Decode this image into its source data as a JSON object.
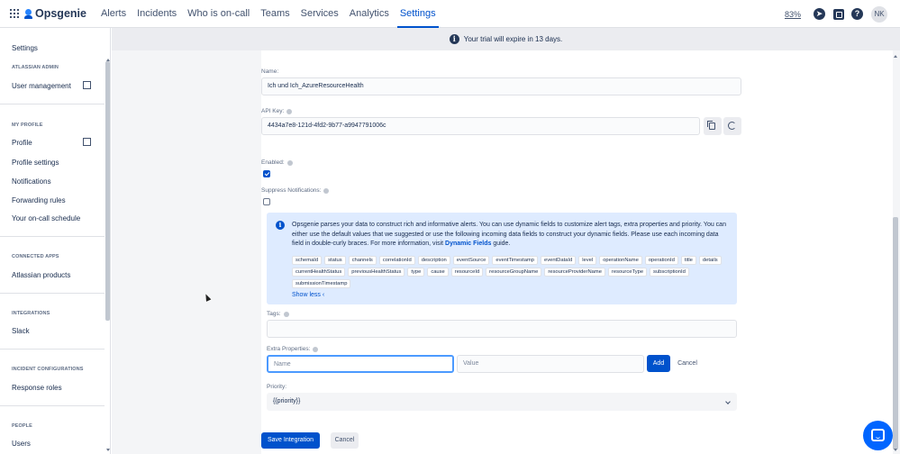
{
  "app": {
    "name": "Opsgenie"
  },
  "topnav": {
    "items": [
      "Alerts",
      "Incidents",
      "Who is on-call",
      "Teams",
      "Services",
      "Analytics",
      "Settings"
    ],
    "active": "Settings",
    "zoom": "83%",
    "avatar_initials": "NK"
  },
  "sidebar": {
    "settings": "Settings",
    "atlassian_admin_head": "ATLASSIAN ADMIN",
    "user_management": "User management",
    "my_profile_head": "MY PROFILE",
    "profile": "Profile",
    "profile_settings": "Profile settings",
    "notifications": "Notifications",
    "forwarding_rules": "Forwarding rules",
    "oncall_schedule": "Your on-call schedule",
    "connected_apps_head": "CONNECTED APPS",
    "atlassian_products": "Atlassian products",
    "integrations_head": "INTEGRATIONS",
    "slack": "Slack",
    "incident_config_head": "INCIDENT CONFIGURATIONS",
    "response_roles": "Response roles",
    "people_head": "PEOPLE",
    "users": "Users"
  },
  "banner": {
    "trial_text": "Your trial will expire in 13 days."
  },
  "form": {
    "name_label": "Name:",
    "name_value": "Ich und Ich_AzureResourceHealth",
    "api_key_label": "API Key:",
    "api_key_value": "4434a7e8-121d-4fd2-9b77-a9947791006c",
    "enabled_label": "Enabled:",
    "enabled": true,
    "suppress_label": "Suppress Notifications:",
    "suppress": false,
    "info_text": "Opsgenie parses your data to construct rich and informative alerts. You can use dynamic fields to customize alert tags, extra properties and priority. You can either use the default values that we suggested or use the following incoming data fields to construct your dynamic fields. Please use each incoming data field in double-curly braces. For more information, visit ",
    "info_link": "Dynamic Fields",
    "info_suffix": " guide.",
    "fields": [
      "schemaId",
      "status",
      "channels",
      "correlationId",
      "description",
      "eventSource",
      "eventTimestamp",
      "eventDataId",
      "level",
      "operationName",
      "operationId",
      "title",
      "details",
      "currentHealthStatus",
      "previousHealthStatus",
      "type",
      "cause",
      "resourceId",
      "resourceGroupName",
      "resourceProviderName",
      "resourceType",
      "subscriptionId",
      "submissionTimestamp"
    ],
    "show_less": "Show less",
    "tags_label": "Tags:",
    "extra_label": "Extra Properties:",
    "extra_name_placeholder": "Name",
    "extra_value_placeholder": "Value",
    "add_label": "Add",
    "cancel_label": "Cancel",
    "priority_label": "Priority:",
    "priority_value": "{{priority}}",
    "save_label": "Save Integration",
    "cancel2_label": "Cancel"
  }
}
